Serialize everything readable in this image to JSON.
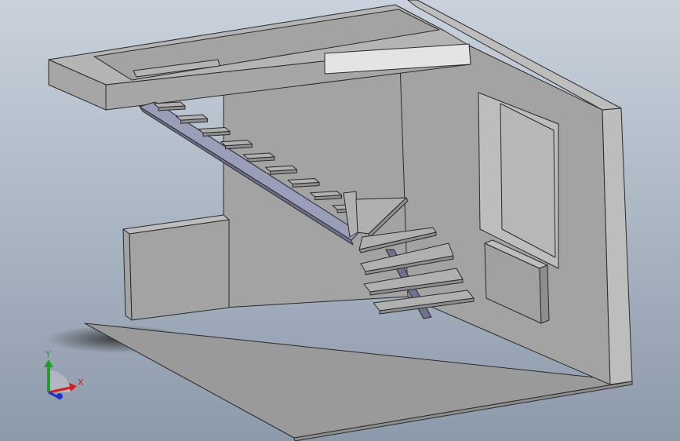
{
  "viewport": {
    "background_top": "#c9d2dc",
    "background_bottom": "#8d9aab",
    "shadow_color": "#2b2b2b"
  },
  "model": {
    "colors": {
      "floor": "#9a9a9a",
      "wall_face": "#a3a3a3",
      "wall_side": "#bdbdbd",
      "wall_edge": "#8e8e8e",
      "slab_top": "#b4b4b4",
      "slab_front": "#a6a6a6",
      "slab_highlight": "#e4e4e4",
      "tread": "#b0b0b0",
      "tread_front": "#8e8e8e",
      "stringer": "#9a9eb8",
      "stringer_dark": "#6e7290",
      "window_glass": "#b7b7b7",
      "radiator": "#a1a1a1",
      "outline": "#2a2a2a"
    }
  },
  "triad": {
    "x_label": "X",
    "y_label": "Y",
    "x_color": "#d21e1e",
    "y_color": "#1f9e2a",
    "z_color": "#2233c8",
    "disc_color": "#b8b8c6",
    "x_icon": "x-axis-arrow-icon",
    "y_icon": "y-axis-arrow-icon",
    "z_icon": "z-axis-arrow-icon"
  }
}
